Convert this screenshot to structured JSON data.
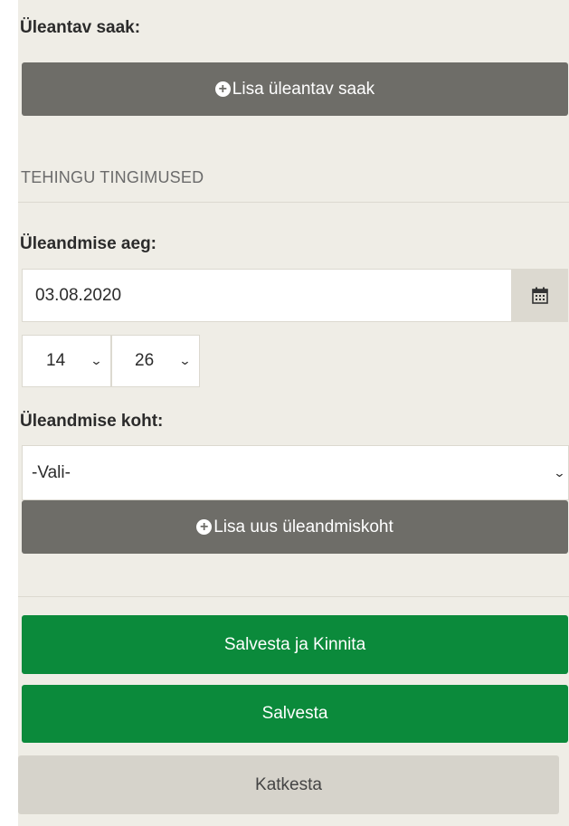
{
  "transferred_crop": {
    "label": "Üleantav saak:",
    "add_button_label": "Lisa üleantav saak"
  },
  "terms": {
    "section_title": "TEHINGU TINGIMUSED",
    "time_label": "Üleandmise aeg:",
    "date_value": "03.08.2020",
    "hour_value": "14",
    "minute_value": "26",
    "place_label": "Üleandmise koht:",
    "place_value": "-Vali-",
    "add_place_label": "Lisa uus üleandmiskoht"
  },
  "actions": {
    "save_confirm_label": "Salvesta ja Kinnita",
    "save_label": "Salvesta",
    "cancel_label": "Katkesta"
  },
  "icons": {
    "plus": "plus-circle-icon",
    "calendar": "calendar-icon",
    "dropdown": "chevron-down-icon"
  },
  "colors": {
    "panel_background": "#efede6",
    "gray_button": "#6e6d68",
    "green_button": "#0b8a3b",
    "light_button": "#d6d3cb"
  }
}
